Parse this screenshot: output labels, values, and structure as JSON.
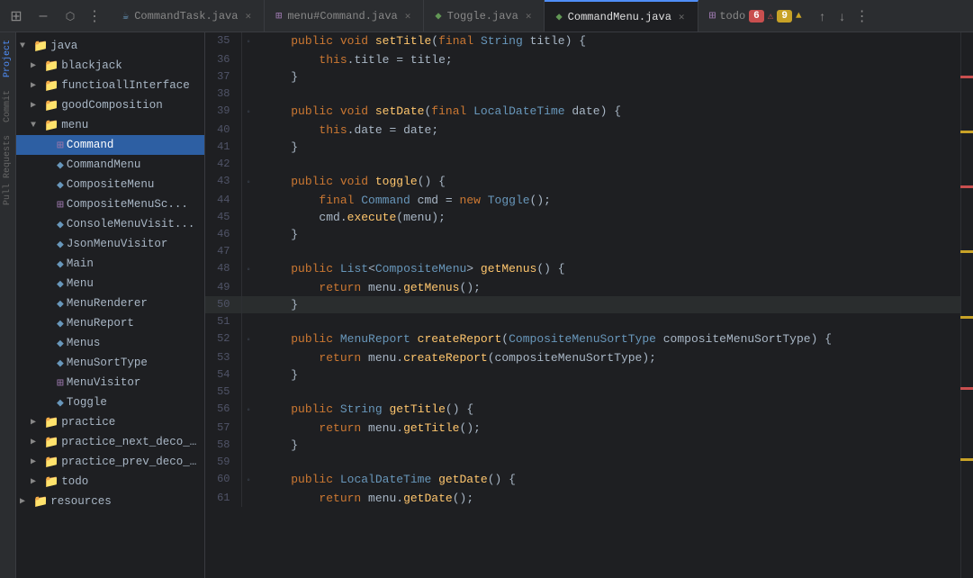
{
  "tabBar": {
    "windowButtons": [
      "⊞",
      "–",
      "□"
    ],
    "tabs": [
      {
        "id": "tab-command-task",
        "label": "CommandTask.java",
        "icon": "☕",
        "iconColor": "#6897bb",
        "active": false,
        "closable": true
      },
      {
        "id": "tab-menu-command",
        "label": "menu#Command.java",
        "icon": "⊞",
        "iconColor": "#9876aa",
        "active": false,
        "closable": true
      },
      {
        "id": "tab-toggle",
        "label": "Toggle.java",
        "icon": "☁",
        "iconColor": "#629755",
        "active": false,
        "closable": true
      },
      {
        "id": "tab-command-menu",
        "label": "CommandMenu.java",
        "icon": "☁",
        "iconColor": "#629755",
        "active": true,
        "closable": true
      }
    ],
    "todo": {
      "label": "todo",
      "errorCount": "6",
      "warnCount": "9"
    }
  },
  "fileTree": {
    "items": [
      {
        "id": "java",
        "label": "java",
        "type": "folder",
        "indent": 0,
        "expanded": true
      },
      {
        "id": "blackjack",
        "label": "blackjack",
        "type": "folder",
        "indent": 1,
        "expanded": false
      },
      {
        "id": "functioallInterface",
        "label": "functioallInterface",
        "type": "folder",
        "indent": 1,
        "expanded": false
      },
      {
        "id": "goodComposition",
        "label": "goodComposition",
        "type": "folder",
        "indent": 1,
        "expanded": false
      },
      {
        "id": "menu",
        "label": "menu",
        "type": "folder",
        "indent": 1,
        "expanded": true
      },
      {
        "id": "Command",
        "label": "Command",
        "type": "interface",
        "indent": 2,
        "selected": true
      },
      {
        "id": "CommandMenu",
        "label": "CommandMenu",
        "type": "class",
        "indent": 2
      },
      {
        "id": "CompositeMenu",
        "label": "CompositeMenu",
        "type": "class",
        "indent": 2
      },
      {
        "id": "CompositeMenuSo",
        "label": "CompositeMenuSo...",
        "type": "grid",
        "indent": 2
      },
      {
        "id": "ConsoleMenuVisit",
        "label": "ConsoleMenuVisit...",
        "type": "class",
        "indent": 2
      },
      {
        "id": "JsonMenuVisitor",
        "label": "JsonMenuVisitor",
        "type": "class",
        "indent": 2
      },
      {
        "id": "Main",
        "label": "Main",
        "type": "class",
        "indent": 2
      },
      {
        "id": "Menu",
        "label": "Menu",
        "type": "class",
        "indent": 2
      },
      {
        "id": "MenuRenderer",
        "label": "MenuRenderer",
        "type": "class",
        "indent": 2
      },
      {
        "id": "MenuReport",
        "label": "MenuReport",
        "type": "class",
        "indent": 2
      },
      {
        "id": "Menus",
        "label": "Menus",
        "type": "class",
        "indent": 2
      },
      {
        "id": "MenuSortType",
        "label": "MenuSortType",
        "type": "class",
        "indent": 2
      },
      {
        "id": "MenuVisitor",
        "label": "MenuVisitor",
        "type": "interface",
        "indent": 2
      },
      {
        "id": "Toggle",
        "label": "Toggle",
        "type": "class",
        "indent": 2
      },
      {
        "id": "practice",
        "label": "practice",
        "type": "folder",
        "indent": 1,
        "expanded": false
      },
      {
        "id": "practice_next_deco_fo",
        "label": "practice_next_deco_fo...",
        "type": "folder",
        "indent": 1,
        "expanded": false
      },
      {
        "id": "practice_prev_deco_fo",
        "label": "practice_prev_deco_fo...",
        "type": "folder",
        "indent": 1,
        "expanded": false
      },
      {
        "id": "todo",
        "label": "todo",
        "type": "folder",
        "indent": 1,
        "expanded": false
      },
      {
        "id": "resources",
        "label": "resources",
        "type": "folder",
        "indent": 0,
        "expanded": false
      }
    ]
  },
  "codeLines": [
    {
      "num": 35,
      "gutter": "◦",
      "code": "    public void setTitle(final String title) {"
    },
    {
      "num": 36,
      "gutter": "",
      "code": "        this.title = title;"
    },
    {
      "num": 37,
      "gutter": "",
      "code": "    }"
    },
    {
      "num": 38,
      "gutter": "",
      "code": ""
    },
    {
      "num": 39,
      "gutter": "◦",
      "code": "    public void setDate(final LocalDateTime date) {"
    },
    {
      "num": 40,
      "gutter": "",
      "code": "        this.date = date;"
    },
    {
      "num": 41,
      "gutter": "",
      "code": "    }"
    },
    {
      "num": 42,
      "gutter": "",
      "code": ""
    },
    {
      "num": 43,
      "gutter": "◦",
      "code": "    public void toggle() {"
    },
    {
      "num": 44,
      "gutter": "",
      "code": "        final Command cmd = new Toggle();"
    },
    {
      "num": 45,
      "gutter": "",
      "code": "        cmd.execute(menu);"
    },
    {
      "num": 46,
      "gutter": "",
      "code": "    }"
    },
    {
      "num": 47,
      "gutter": "",
      "code": ""
    },
    {
      "num": 48,
      "gutter": "◦",
      "code": "    public List<CompositeMenu> getMenus() {"
    },
    {
      "num": 49,
      "gutter": "",
      "code": "        return menu.getMenus();"
    },
    {
      "num": 50,
      "gutter": "",
      "code": "    }",
      "cursor": true
    },
    {
      "num": 51,
      "gutter": "",
      "code": ""
    },
    {
      "num": 52,
      "gutter": "◦",
      "code": "    public MenuReport createReport(CompositeMenuSortType compositeMenuSortType) {"
    },
    {
      "num": 53,
      "gutter": "",
      "code": "        return menu.createReport(compositeMenuSortType);"
    },
    {
      "num": 54,
      "gutter": "",
      "code": "    }"
    },
    {
      "num": 55,
      "gutter": "",
      "code": ""
    },
    {
      "num": 56,
      "gutter": "◦",
      "code": "    public String getTitle() {"
    },
    {
      "num": 57,
      "gutter": "",
      "code": "        return menu.getTitle();"
    },
    {
      "num": 58,
      "gutter": "",
      "code": "    }"
    },
    {
      "num": 59,
      "gutter": "",
      "code": ""
    },
    {
      "num": 60,
      "gutter": "◦",
      "code": "    public LocalDateTime getDate() {"
    },
    {
      "num": 61,
      "gutter": "",
      "code": "        return menu.getDate();"
    }
  ],
  "sidebar": {
    "labels": [
      "Project",
      "Commit",
      "Pull Requests"
    ]
  }
}
